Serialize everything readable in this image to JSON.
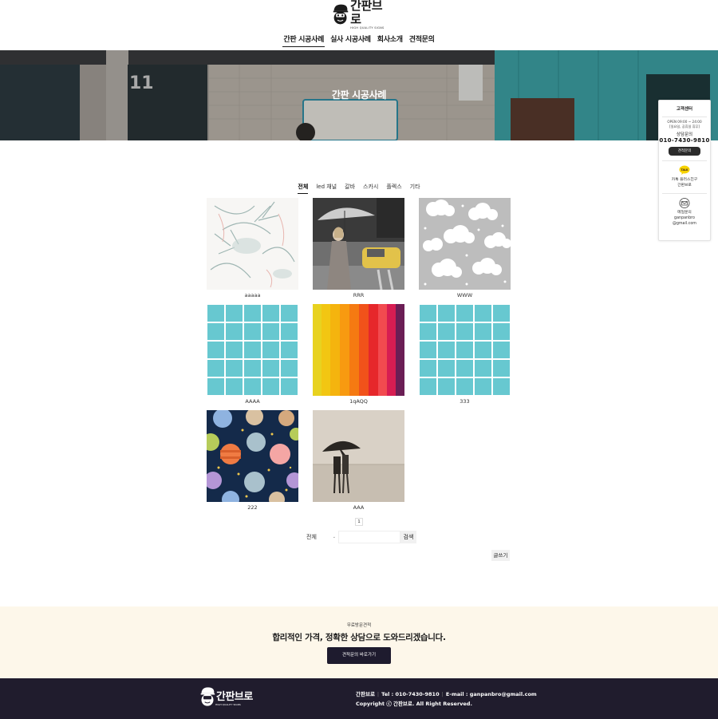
{
  "brand": {
    "name": "간판브로",
    "tagline": "HIGH QUALITY SIGNS"
  },
  "nav": [
    {
      "label": "간판 시공사례",
      "active": true
    },
    {
      "label": "실사 시공사례",
      "active": false
    },
    {
      "label": "회사소개",
      "active": false
    },
    {
      "label": "견적문의",
      "active": false
    }
  ],
  "hero": {
    "title": "간판 시공사례"
  },
  "categories": [
    {
      "label": "전체",
      "active": true
    },
    {
      "label": "led 채널",
      "active": false
    },
    {
      "label": "갈바",
      "active": false
    },
    {
      "label": "스카시",
      "active": false
    },
    {
      "label": "플렉스",
      "active": false
    },
    {
      "label": "기타",
      "active": false
    }
  ],
  "gallery": [
    {
      "caption": "aaaaa",
      "image": "leaf-pattern"
    },
    {
      "caption": "RRR",
      "image": "street-photo"
    },
    {
      "caption": "WWW",
      "image": "cloud-pattern"
    },
    {
      "caption": "AAAA",
      "image": "teal-grid"
    },
    {
      "caption": "1qAQQ",
      "image": "color-stripes"
    },
    {
      "caption": "333",
      "image": "teal-grid"
    },
    {
      "caption": "222",
      "image": "planet-pattern"
    },
    {
      "caption": "AAA",
      "image": "umbrella-photo"
    }
  ],
  "pagination": {
    "current": "1"
  },
  "search": {
    "select_value": "전체",
    "button_label": "검색",
    "placeholder": ""
  },
  "write_button": "글쓰기",
  "side_widget": {
    "title": "고객센터",
    "hours": "OPEN 09:00 ~ 24:00",
    "hours_note": "[일요일, 공휴일 휴무]",
    "phone_label": "상담문의",
    "phone": "010-7430-9810",
    "estimate_button": "견적문의",
    "kakao_badge": "TALK",
    "kakao_text_1": "카톡 플러스친구",
    "kakao_text_2": "간판브로",
    "mail_label": "메일문의",
    "mail_1": "ganpanbro",
    "mail_2": "@gmail.com"
  },
  "cta": {
    "small": "무료방문견적",
    "headline": "합리적인 가격, 정확한 상담으로 도와드리겠습니다.",
    "button": "견적문의 바로가기"
  },
  "footer": {
    "company": "간판브로",
    "tel": "Tel : 010-7430-9810",
    "email": "E-mail : ganpanbro@gmail.com",
    "copyright": "Copyright ⓒ 간판브로. All Right Reserved."
  },
  "colors": {
    "dark": "#201c2d",
    "cta_bg": "#fdf7ea",
    "teal": "#67c8d0"
  }
}
